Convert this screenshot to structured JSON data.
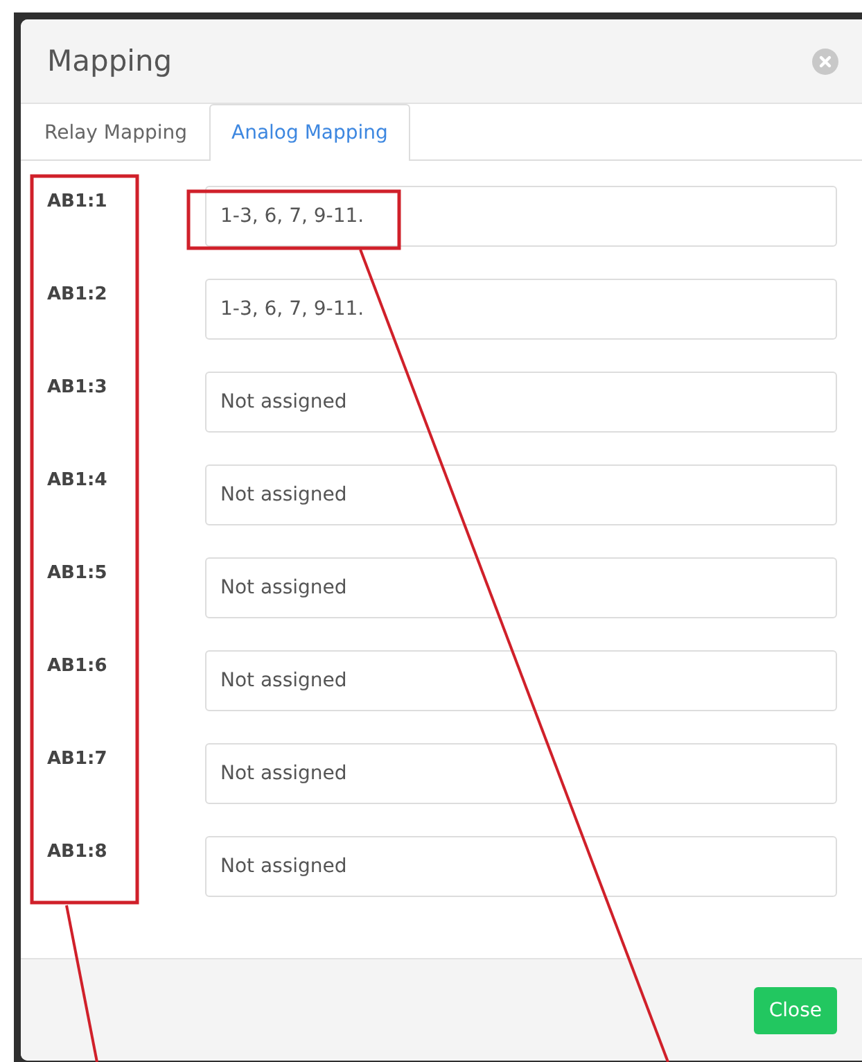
{
  "dialog": {
    "title": "Mapping"
  },
  "tabs": [
    {
      "label": "Relay Mapping",
      "selected": false
    },
    {
      "label": "Analog Mapping",
      "selected": true
    }
  ],
  "rows": [
    {
      "label": "AB1:1",
      "value": "1-3, 6, 7, 9-11."
    },
    {
      "label": "AB1:2",
      "value": "1-3, 6, 7, 9-11."
    },
    {
      "label": "AB1:3",
      "value": "Not assigned"
    },
    {
      "label": "AB1:4",
      "value": "Not assigned"
    },
    {
      "label": "AB1:5",
      "value": "Not assigned"
    },
    {
      "label": "AB1:6",
      "value": "Not assigned"
    },
    {
      "label": "AB1:7",
      "value": "Not assigned"
    },
    {
      "label": "AB1:8",
      "value": "Not assigned"
    }
  ],
  "footer": {
    "button": "Close"
  }
}
